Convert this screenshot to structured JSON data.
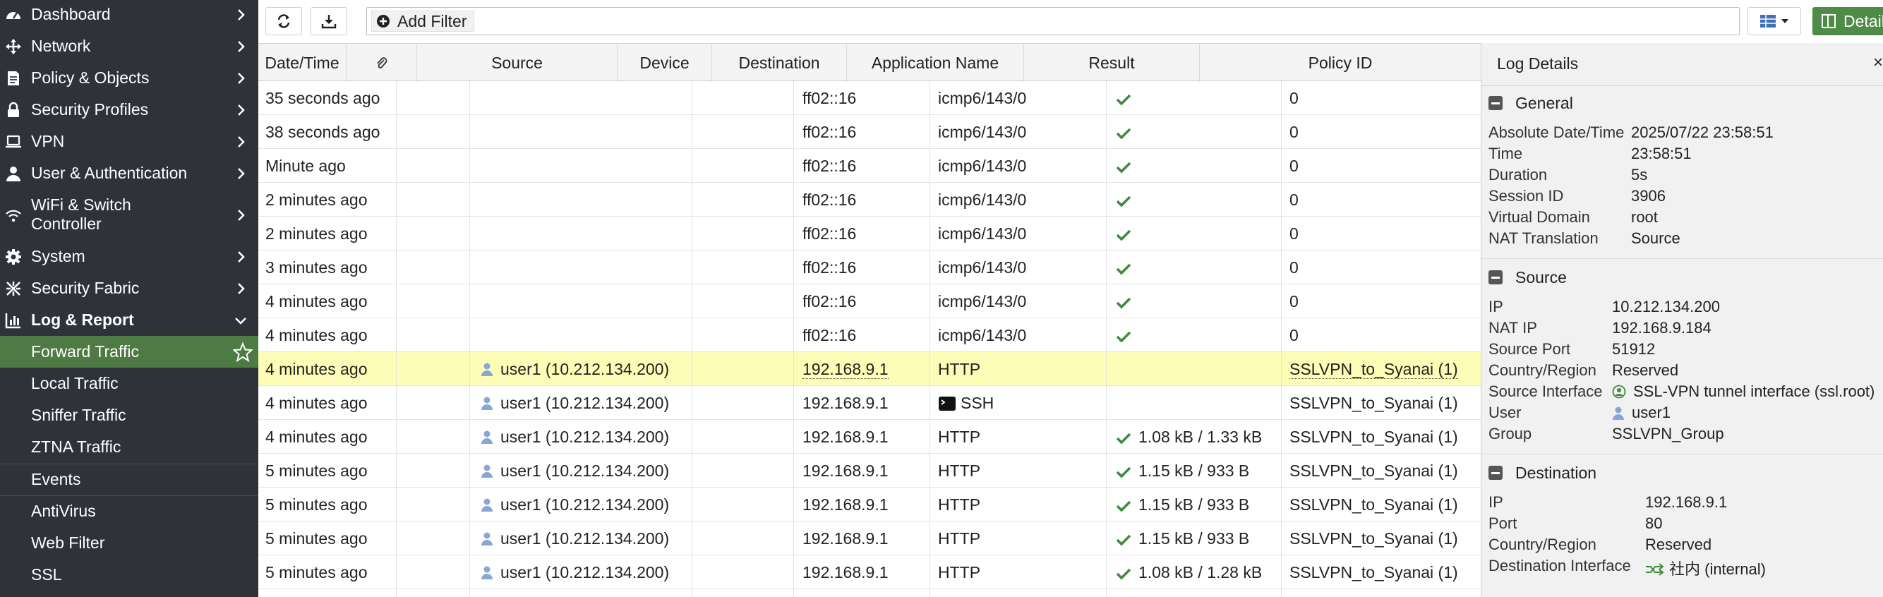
{
  "sidebar": {
    "items": [
      {
        "label": "Dashboard",
        "icon": "dashboard-icon"
      },
      {
        "label": "Network",
        "icon": "network-icon"
      },
      {
        "label": "Policy & Objects",
        "icon": "policy-icon"
      },
      {
        "label": "Security Profiles",
        "icon": "lock-icon"
      },
      {
        "label": "VPN",
        "icon": "laptop-icon"
      },
      {
        "label": "User & Authentication",
        "icon": "user-icon"
      },
      {
        "label": "WiFi & Switch",
        "label2": "Controller",
        "icon": "wifi-icon"
      },
      {
        "label": "System",
        "icon": "gear-icon"
      },
      {
        "label": "Security Fabric",
        "icon": "fabric-icon"
      },
      {
        "label": "Log & Report",
        "icon": "chart-icon"
      }
    ],
    "log_children": [
      "Forward Traffic",
      "Local Traffic",
      "Sniffer Traffic",
      "ZTNA Traffic",
      "Events",
      "AntiVirus",
      "Web Filter",
      "SSL"
    ]
  },
  "toolbar": {
    "add_filter": "Add Filter",
    "details": "Details"
  },
  "table": {
    "columns": [
      "Date/Time",
      "",
      "Source",
      "Device",
      "Destination",
      "Application Name",
      "Result",
      "Policy ID"
    ],
    "rows": [
      {
        "time": "35 seconds ago",
        "source": "",
        "dest": "ff02::16",
        "app": "icmp6/143/0",
        "result": "",
        "ok": true,
        "policy": "0"
      },
      {
        "time": "38 seconds ago",
        "source": "",
        "dest": "ff02::16",
        "app": "icmp6/143/0",
        "result": "",
        "ok": true,
        "policy": "0"
      },
      {
        "time": "Minute ago",
        "source": "",
        "dest": "ff02::16",
        "app": "icmp6/143/0",
        "result": "",
        "ok": true,
        "policy": "0"
      },
      {
        "time": "2 minutes ago",
        "source": "",
        "dest": "ff02::16",
        "app": "icmp6/143/0",
        "result": "",
        "ok": true,
        "policy": "0"
      },
      {
        "time": "2 minutes ago",
        "source": "",
        "dest": "ff02::16",
        "app": "icmp6/143/0",
        "result": "",
        "ok": true,
        "policy": "0"
      },
      {
        "time": "3 minutes ago",
        "source": "",
        "dest": "ff02::16",
        "app": "icmp6/143/0",
        "result": "",
        "ok": true,
        "policy": "0"
      },
      {
        "time": "4 minutes ago",
        "source": "",
        "dest": "ff02::16",
        "app": "icmp6/143/0",
        "result": "",
        "ok": true,
        "policy": "0"
      },
      {
        "time": "4 minutes ago",
        "source": "",
        "dest": "ff02::16",
        "app": "icmp6/143/0",
        "result": "",
        "ok": true,
        "policy": "0"
      },
      {
        "time": "4 minutes ago",
        "source": "user1 (10.212.134.200)",
        "dest": "192.168.9.1",
        "app": "HTTP",
        "result": "",
        "ok": false,
        "policy": "SSLVPN_to_Syanai (1)"
      },
      {
        "time": "4 minutes ago",
        "source": "user1 (10.212.134.200)",
        "dest": "192.168.9.1",
        "app": "SSH",
        "result": "",
        "ok": false,
        "policy": "SSLVPN_to_Syanai (1)"
      },
      {
        "time": "4 minutes ago",
        "source": "user1 (10.212.134.200)",
        "dest": "192.168.9.1",
        "app": "HTTP",
        "result": "1.08 kB / 1.33 kB",
        "ok": true,
        "policy": "SSLVPN_to_Syanai (1)"
      },
      {
        "time": "5 minutes ago",
        "source": "user1 (10.212.134.200)",
        "dest": "192.168.9.1",
        "app": "HTTP",
        "result": "1.15 kB / 933 B",
        "ok": true,
        "policy": "SSLVPN_to_Syanai (1)"
      },
      {
        "time": "5 minutes ago",
        "source": "user1 (10.212.134.200)",
        "dest": "192.168.9.1",
        "app": "HTTP",
        "result": "1.15 kB / 933 B",
        "ok": true,
        "policy": "SSLVPN_to_Syanai (1)"
      },
      {
        "time": "5 minutes ago",
        "source": "user1 (10.212.134.200)",
        "dest": "192.168.9.1",
        "app": "HTTP",
        "result": "1.15 kB / 933 B",
        "ok": true,
        "policy": "SSLVPN_to_Syanai (1)"
      },
      {
        "time": "5 minutes ago",
        "source": "user1 (10.212.134.200)",
        "dest": "192.168.9.1",
        "app": "HTTP",
        "result": "1.08 kB / 1.28 kB",
        "ok": true,
        "policy": "SSLVPN_to_Syanai (1)"
      }
    ]
  },
  "details": {
    "title": "Log Details",
    "general": {
      "title": "General",
      "fields": [
        {
          "k": "Absolute Date/Time",
          "v": "2025/07/22 23:58:51"
        },
        {
          "k": "Time",
          "v": "23:58:51"
        },
        {
          "k": "Duration",
          "v": "5s"
        },
        {
          "k": "Session ID",
          "v": "3906"
        },
        {
          "k": "Virtual Domain",
          "v": "root"
        },
        {
          "k": "NAT Translation",
          "v": "Source"
        }
      ]
    },
    "source": {
      "title": "Source",
      "fields": [
        {
          "k": "IP",
          "v": "10.212.134.200"
        },
        {
          "k": "NAT IP",
          "v": "192.168.9.184"
        },
        {
          "k": "Source Port",
          "v": "51912"
        },
        {
          "k": "Country/Region",
          "v": "Reserved"
        },
        {
          "k": "Source Interface",
          "v": "SSL-VPN tunnel interface (ssl.root)"
        },
        {
          "k": "User",
          "v": "user1"
        },
        {
          "k": "Group",
          "v": "SSLVPN_Group"
        }
      ]
    },
    "destination": {
      "title": "Destination",
      "fields": [
        {
          "k": "IP",
          "v": "192.168.9.1"
        },
        {
          "k": "Port",
          "v": "80"
        },
        {
          "k": "Country/Region",
          "v": "Reserved"
        },
        {
          "k": "Destination Interface",
          "v": "社内 (internal)"
        }
      ]
    }
  },
  "colors": {
    "sidebar_bg": "#2f3238",
    "active_green": "#4d7b43",
    "selected_row": "#fdfdb7",
    "check_green": "#3f8a3c"
  }
}
